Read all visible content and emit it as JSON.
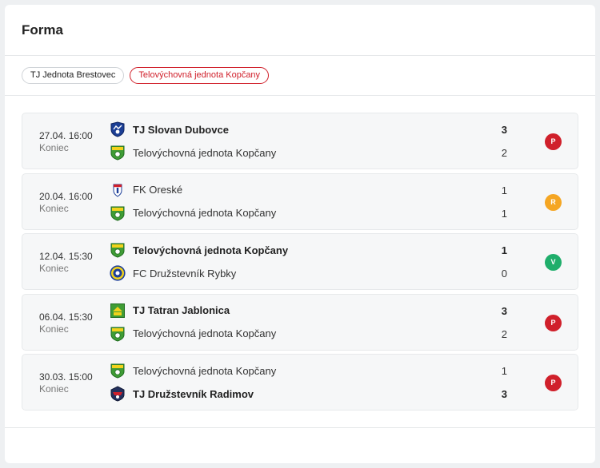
{
  "title": "Forma",
  "tabs": [
    {
      "label": "TJ Jednota Brestovec",
      "active": false
    },
    {
      "label": "Telovýchovná jednota Kopčany",
      "active": true
    }
  ],
  "matches": [
    {
      "date": "27.04. 16:00",
      "status": "Koniec",
      "home": {
        "name": "TJ Slovan Dubovce",
        "score": "3",
        "logo": "dubovce-crest",
        "winner": true
      },
      "away": {
        "name": "Telovýchovná jednota Kopčany",
        "score": "2",
        "logo": "kopcany-crest",
        "winner": false
      },
      "result": "P",
      "result_color": "#d0202b"
    },
    {
      "date": "20.04. 16:00",
      "status": "Koniec",
      "home": {
        "name": "FK Oreské",
        "score": "1",
        "logo": "oreske-crest",
        "winner": false
      },
      "away": {
        "name": "Telovýchovná jednota Kopčany",
        "score": "1",
        "logo": "kopcany-crest",
        "winner": false
      },
      "result": "R",
      "result_color": "#f5a623"
    },
    {
      "date": "12.04. 15:30",
      "status": "Koniec",
      "home": {
        "name": "Telovýchovná jednota Kopčany",
        "score": "1",
        "logo": "kopcany-crest",
        "winner": true
      },
      "away": {
        "name": "FC Družstevník Rybky",
        "score": "0",
        "logo": "rybky-crest",
        "winner": false
      },
      "result": "V",
      "result_color": "#1fae6b"
    },
    {
      "date": "06.04. 15:30",
      "status": "Koniec",
      "home": {
        "name": "TJ Tatran Jablonica",
        "score": "3",
        "logo": "jablonica-crest",
        "winner": true
      },
      "away": {
        "name": "Telovýchovná jednota Kopčany",
        "score": "2",
        "logo": "kopcany-crest",
        "winner": false
      },
      "result": "P",
      "result_color": "#d0202b"
    },
    {
      "date": "30.03. 15:00",
      "status": "Koniec",
      "home": {
        "name": "Telovýchovná jednota Kopčany",
        "score": "1",
        "logo": "kopcany-crest",
        "winner": false
      },
      "away": {
        "name": "TJ Družstevník Radimov",
        "score": "3",
        "logo": "radimov-crest",
        "winner": true
      },
      "result": "P",
      "result_color": "#d0202b"
    }
  ]
}
